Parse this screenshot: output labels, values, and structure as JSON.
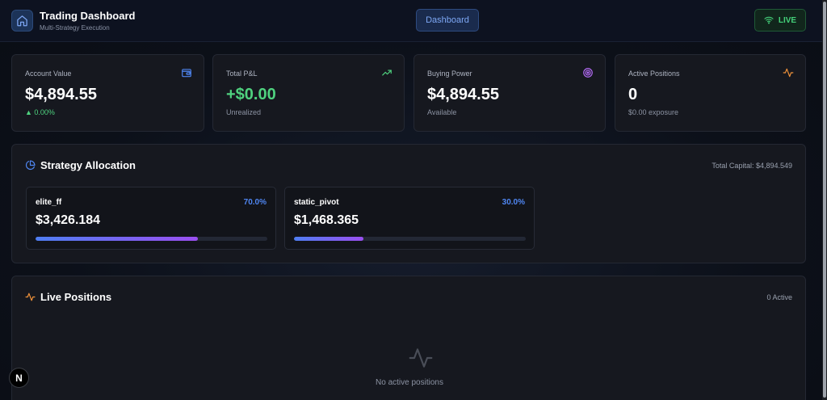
{
  "header": {
    "title": "Trading Dashboard",
    "subtitle": "Multi-Strategy Execution",
    "nav_label": "Dashboard",
    "status_label": "LIVE",
    "icons": [
      "home-icon",
      "wifi-icon"
    ]
  },
  "stats": [
    {
      "label": "Account Value",
      "value": "$4,894.55",
      "sub": "▲ 0.00%",
      "icon": "wallet-icon"
    },
    {
      "label": "Total P&L",
      "value": "+$0.00",
      "sub": "Unrealized",
      "icon": "trending-up-icon"
    },
    {
      "label": "Buying Power",
      "value": "$4,894.55",
      "sub": "Available",
      "icon": "target-icon"
    },
    {
      "label": "Active Positions",
      "value": "0",
      "sub": "$0.00 exposure",
      "icon": "activity-icon"
    }
  ],
  "allocation": {
    "title": "Strategy Allocation",
    "meta": "Total Capital: $4,894.549",
    "icon": "pie-chart-icon",
    "strategies": [
      {
        "name": "elite_ff",
        "pct": "70.0%",
        "amount": "$3,426.184",
        "fill": 0.7
      },
      {
        "name": "static_pivot",
        "pct": "30.0%",
        "amount": "$1,468.365",
        "fill": 0.3
      }
    ]
  },
  "positions": {
    "title": "Live Positions",
    "meta": "0 Active",
    "icon": "activity-icon",
    "empty_text": "No active positions"
  },
  "badge": {
    "label": "N"
  },
  "colors": {
    "accent_blue": "#4f86f2",
    "positive_green": "#4fd27f",
    "purple": "#9a4ff0",
    "orange": "#f0923a",
    "background": "#0c1019",
    "card": "#16181f"
  }
}
